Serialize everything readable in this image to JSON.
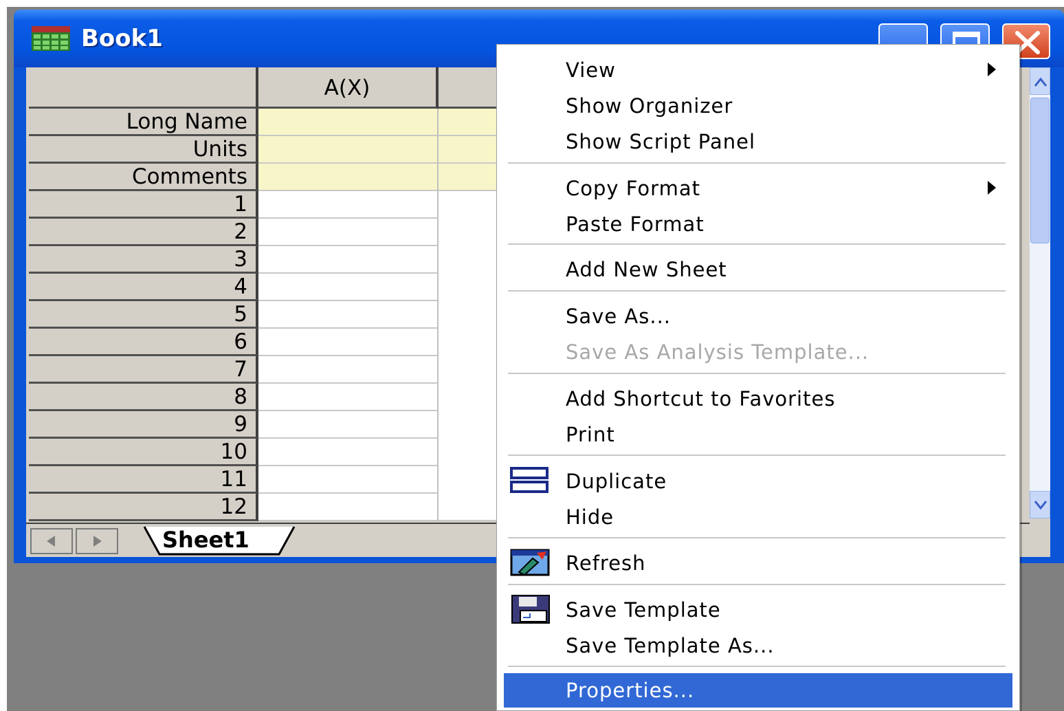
{
  "window": {
    "title": "Book1"
  },
  "grid": {
    "column_header": "A(X)",
    "row_labels": [
      "Long Name",
      "Units",
      "Comments",
      "1",
      "2",
      "3",
      "4",
      "5",
      "6",
      "7",
      "8",
      "9",
      "10",
      "11",
      "12"
    ]
  },
  "sheet_tabs": {
    "active": "Sheet1"
  },
  "context_menu": {
    "items": [
      {
        "label": "View",
        "submenu": true
      },
      {
        "label": "Show Organizer"
      },
      {
        "label": "Show Script Panel"
      },
      {
        "label": "Copy Format",
        "submenu": true
      },
      {
        "label": "Paste Format"
      },
      {
        "label": "Add New Sheet"
      },
      {
        "label": "Save As..."
      },
      {
        "label": "Save As Analysis Template...",
        "disabled": true
      },
      {
        "label": "Add Shortcut to Favorites"
      },
      {
        "label": "Print"
      },
      {
        "label": "Duplicate",
        "icon": "duplicate-icon"
      },
      {
        "label": "Hide"
      },
      {
        "label": "Refresh",
        "icon": "refresh-icon"
      },
      {
        "label": "Save Template",
        "icon": "floppy-disk-icon"
      },
      {
        "label": "Save Template As..."
      },
      {
        "label": "Properties...",
        "selected": true
      }
    ]
  },
  "colors": {
    "titlebar": "#0554df",
    "menu_highlight": "#3168d5",
    "label_row_fill": "#f8f6c8",
    "disabled_text": "#a8a8a8"
  }
}
